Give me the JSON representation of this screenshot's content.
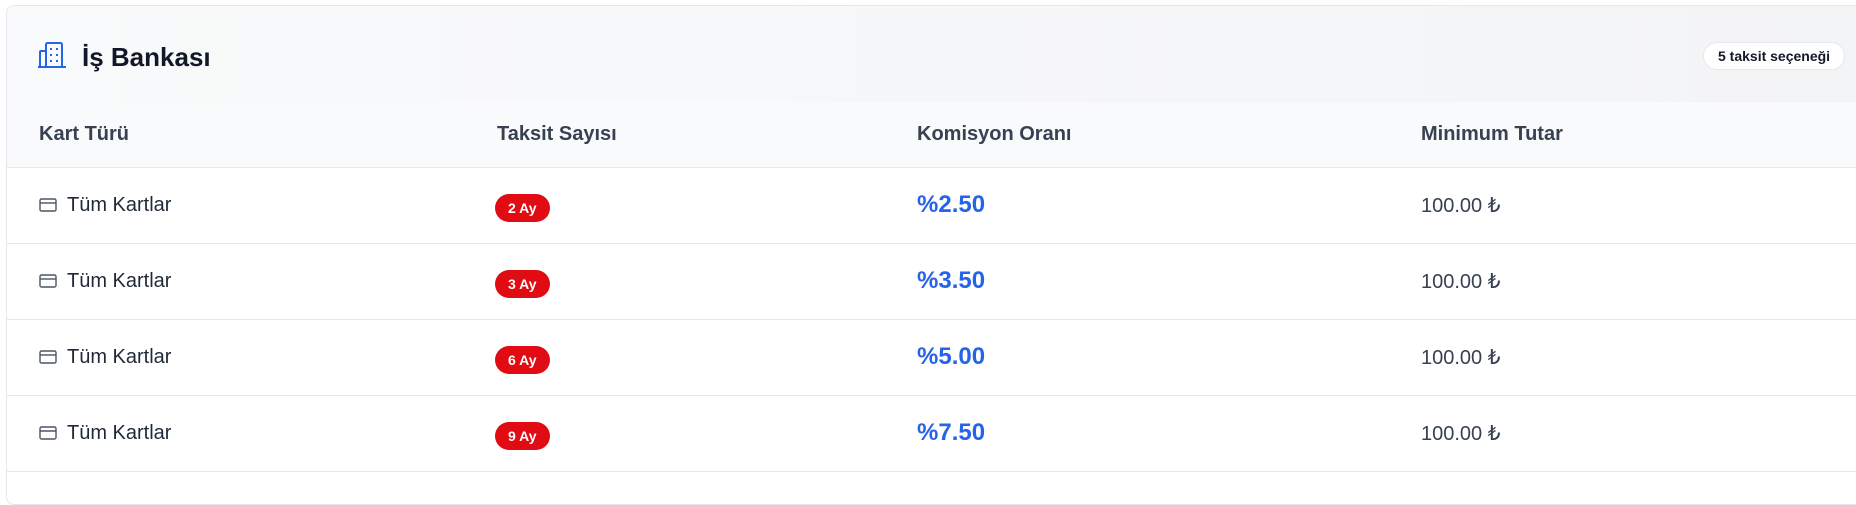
{
  "bank": {
    "name": "İş Bankası",
    "installment_count_badge": "5 taksit seçeneği"
  },
  "table": {
    "headers": [
      "Kart Türü",
      "Taksit Sayısı",
      "Komisyon Oranı",
      "Minimum Tutar"
    ],
    "rows": [
      {
        "card": "Tüm Kartlar",
        "installments": "2 Ay",
        "rate": "%2.50",
        "min": "100.00 ₺"
      },
      {
        "card": "Tüm Kartlar",
        "installments": "3 Ay",
        "rate": "%3.50",
        "min": "100.00 ₺"
      },
      {
        "card": "Tüm Kartlar",
        "installments": "6 Ay",
        "rate": "%5.00",
        "min": "100.00 ₺"
      },
      {
        "card": "Tüm Kartlar",
        "installments": "9 Ay",
        "rate": "%7.50",
        "min": "100.00 ₺"
      }
    ]
  },
  "colors": {
    "accent_blue": "#2563eb",
    "pill_red": "#e00b13"
  },
  "icons": {
    "bank": "building-icon",
    "card": "credit-card-icon"
  }
}
